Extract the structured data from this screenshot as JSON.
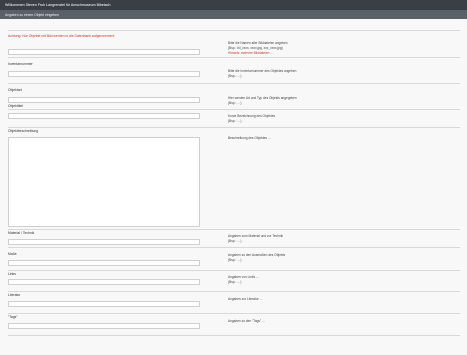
{
  "window": {
    "title": "Willkommen Steven Fruh Langrenstel für Amschmuseum Bibelach"
  },
  "header": {
    "subtitle": "Angaben zu einem Objekt eingeben"
  },
  "form": {
    "notice": "Achtung: Nur Objekte mit Bild werden in die Datenbank aufgenommen!",
    "fields": [
      {
        "label": "",
        "placeholder": "",
        "help": [
          "Bitte die Namen aller Bilddateien angeben",
          "(Bsp.: bil_xxxx, xxxx.jpg, xxx_xxxx.jpg)",
          "Hinweis: mehrere Bilddateien …"
        ],
        "help_red_index": 2
      },
      {
        "label": "Inventarnummer",
        "placeholder": "",
        "help": [
          "Bitte die Inventarnummer des Objektes angeben",
          "(Bsp.: …)"
        ]
      },
      {
        "label": "Objektart",
        "placeholder": "",
        "help": [
          "Hier werden Art und Typ des Objekts angegeben",
          "(Bsp.: …)"
        ]
      },
      {
        "label": "Objekttitel",
        "placeholder": "",
        "help": [
          "Kurze Bezeichnung des Objektes",
          "(Bsp.: …)"
        ]
      },
      {
        "label": "Objektbeschreibung",
        "placeholder": "",
        "help": [
          "Beschreibung des Objektes …"
        ]
      },
      {
        "label": "Material / Technik",
        "placeholder": "",
        "help": [
          "Angaben zum Material und zur Technik",
          "(Bsp.: …)"
        ]
      },
      {
        "label": "Maße",
        "placeholder": "",
        "help": [
          "Angaben zu den Ausmaßen des Objekts",
          "(Bsp.: …)"
        ]
      },
      {
        "label": "Links",
        "placeholder": "",
        "help": [
          "Angaben von Links …",
          "(Bsp.: …)"
        ]
      },
      {
        "label": "Literatur",
        "placeholder": "",
        "help": [
          "Angaben zur Literatur …"
        ]
      },
      {
        "label": "\"Tags\"",
        "placeholder": "",
        "help": [
          "Angaben zu den \"Tags\" …"
        ]
      }
    ]
  }
}
